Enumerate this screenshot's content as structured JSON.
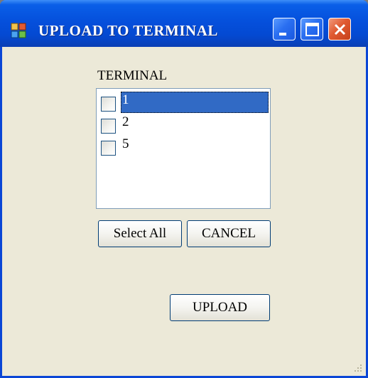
{
  "window": {
    "title": "UPLOAD TO TERMINAL"
  },
  "terminal": {
    "label": "TERMINAL",
    "items": [
      {
        "label": "1",
        "checked": false,
        "selected": true
      },
      {
        "label": "2",
        "checked": false,
        "selected": false
      },
      {
        "label": "5",
        "checked": false,
        "selected": false
      }
    ]
  },
  "buttons": {
    "select_all": "Select All",
    "cancel": "CANCEL",
    "upload": "UPLOAD"
  },
  "colors": {
    "titlebar": "#0550dc",
    "window_bg": "#ece9d8",
    "selection": "#316ac5",
    "close_button": "#e05a32"
  }
}
